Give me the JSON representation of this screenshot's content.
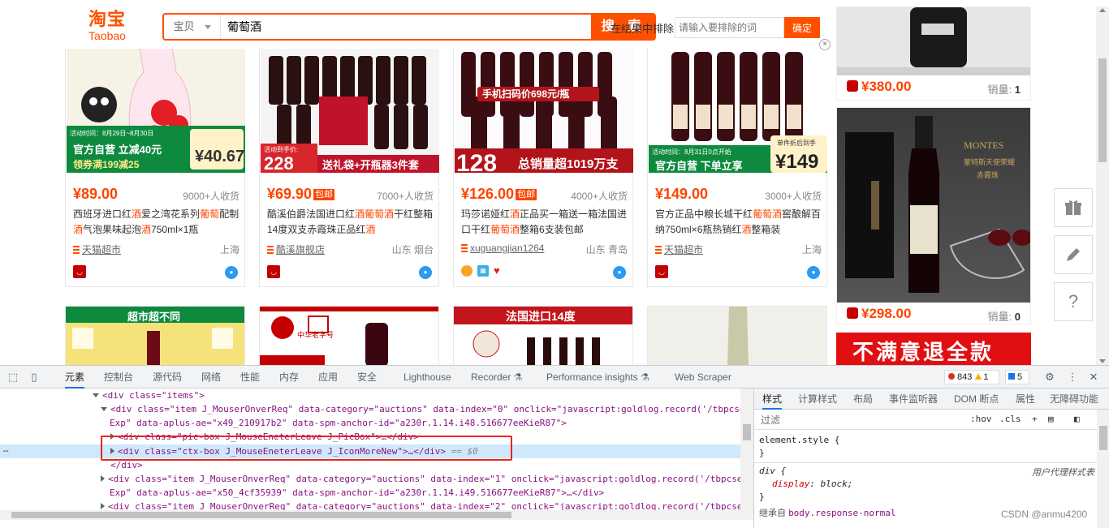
{
  "header": {
    "logo_zh": "淘宝",
    "logo_en": "Taobao",
    "search_type": "宝贝",
    "search_query": "葡萄酒",
    "search_button": "搜 索",
    "exclude_label": "在结果中排除",
    "exclude_placeholder": "请输入要排除的词",
    "exclude_button": "确定",
    "close_icon": "×"
  },
  "products": [
    {
      "price": "¥89.00",
      "tag": "",
      "deals": "9000+人收货",
      "title_parts": [
        "西班牙进口红",
        "酒",
        "爱之湾花系列",
        "葡萄",
        "配制",
        "酒",
        "气泡果味起泡",
        "酒",
        "750ml×1瓶"
      ],
      "shop": "天猫超市",
      "location": "上海",
      "img_promo": "活动时间：8月29日~8月30日",
      "img_line1": "官方自营 立减40元",
      "img_line2": "领券满199减25",
      "img_price": "40.67"
    },
    {
      "price": "¥69.90",
      "tag": "包邮",
      "deals": "7000+人收货",
      "title_parts": [
        "酷溪伯爵法国进口红",
        "酒",
        "",
        "葡萄酒",
        "干红整箱14度双支赤霞珠正品红",
        "酒",
        "",
        "",
        ""
      ],
      "shop": "酷溪旗舰店",
      "location": "山东 烟台",
      "img_promo": "活动到手价:",
      "img_line1": "228",
      "img_line2": "送礼袋+开瓶器3件套",
      "img_price": ""
    },
    {
      "price": "¥126.00",
      "tag": "包邮",
      "deals": "4000+人收货",
      "title_parts": [
        "玛莎诺娅红",
        "酒",
        "正品买一箱送一箱法国进口干红",
        "葡萄酒",
        "整箱6支装包邮",
        "",
        "",
        "",
        ""
      ],
      "shop": "xuguangjian1264",
      "location": "山东 青岛",
      "img_promo": "手机扫码价698元/瓶",
      "img_line1": "128",
      "img_line2": "总销量超1019万支",
      "img_price": ""
    },
    {
      "price": "¥149.00",
      "tag": "",
      "deals": "3000+人收货",
      "title_parts": [
        "官方正品中粮长城干红",
        "葡萄酒",
        "窖酿解百纳750ml×6瓶热销红",
        "酒",
        "整箱装",
        "",
        "",
        "",
        ""
      ],
      "shop": "天猫超市",
      "location": "上海",
      "img_promo": "活动时间：8月31日0点开始",
      "img_line1": "官方自营 下单立享",
      "img_line2": "单件折后到手",
      "img_price": "149"
    }
  ],
  "second_row": [
    "超市超不同",
    "中华老字号",
    "法国进口14度",
    ""
  ],
  "right_column": [
    {
      "price": "¥380.00",
      "sales_label": "销量:",
      "sales": "1"
    },
    {
      "price": "¥298.00",
      "sales_label": "销量:",
      "sales": "0",
      "img_brand": "MONTES",
      "img_sub1": "蒙特斯天使荣耀",
      "img_sub2": "赤霞珠"
    },
    {
      "banner": "不满意退全款"
    }
  ],
  "side_buttons": [
    "gift-icon",
    "edit-icon",
    "help-icon"
  ],
  "devtools": {
    "tabs": [
      "元素",
      "控制台",
      "源代码",
      "网络",
      "性能",
      "内存",
      "应用",
      "安全",
      "Lighthouse",
      "Recorder",
      "Performance insights",
      "Web Scraper"
    ],
    "errors": "843",
    "warnings": "1",
    "messages": "5",
    "dom_lines": [
      {
        "indent": "",
        "text": "<div class=\"items\">"
      },
      {
        "l1": "<div class=\"item J_MouserOnverReq\" data-category=\"auctions\" data-index=\"0\" onclick=\"javascript:goldlog.record('/tbpcse",
        "l1b": "Exp\" data-aplus-ae=\"x49_210917b2\" data-spm-anchor-id=\"a230r.1.14.i48.516677eeKieR87\">"
      },
      {
        "text": "<div class=\"pic-box J_MouseEneterLeave J_PicBox\">…</div>"
      },
      {
        "text": "<div class=\"ctx-box J_MouseEneterLeave J_IconMoreNew\">…</div>",
        "eq": "== $0"
      },
      {
        "text": "</div>"
      },
      {
        "l1": "<div class=\"item J_MouserOnverReq\" data-category=\"auctions\" data-index=\"1\" onclick=\"javascript:goldlog.record('/tbpcse",
        "l1b": "Exp\" data-aplus-ae=\"x50_4cf35939\" data-spm-anchor-id=\"a230r.1.14.i49.516677eeKieR87\">…</div>"
      },
      {
        "text": "<div class=\"item J_MouserOnverReq\" data-category=\"auctions\" data-index=\"2\" onclick=\"javascript:goldlog.record('/tbpcse"
      }
    ],
    "dots": "…",
    "style_tabs": [
      "样式",
      "计算样式",
      "布局",
      "事件监听器",
      "DOM 断点",
      "属性",
      "无障碍功能"
    ],
    "filter_placeholder": "过滤",
    "hov": ":hov",
    "cls": ".cls",
    "element_style": "element.style {",
    "close_brace": "}",
    "div_rule": "div {",
    "ua_note": "用户代理样式表",
    "prop": "display",
    "val": "block;",
    "inherit_label": "继承自",
    "inherit_sel": "body.response-normal"
  },
  "watermark": "CSDN @anmu4200"
}
